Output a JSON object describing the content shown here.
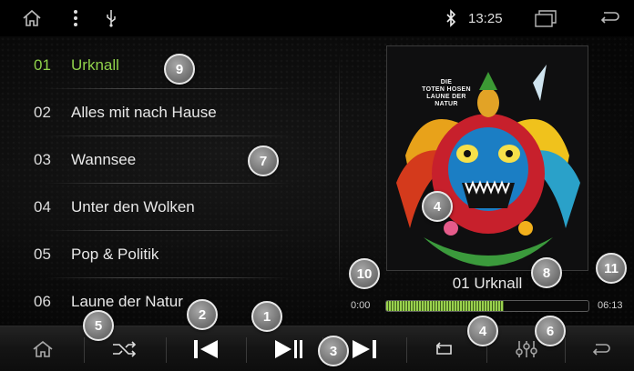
{
  "status_bar": {
    "time": "13:25",
    "icons": {
      "home": "home-icon",
      "menu": "vertical-dots-icon",
      "usb": "usb-icon",
      "bluetooth": "bluetooth-icon",
      "recent": "recent-apps-icon",
      "back": "back-icon"
    }
  },
  "playlist": [
    {
      "num": "01",
      "title": "Urknall",
      "active": true
    },
    {
      "num": "02",
      "title": "Alles mit nach Hause",
      "active": false
    },
    {
      "num": "03",
      "title": "Wannsee",
      "active": false
    },
    {
      "num": "04",
      "title": "Unter den Wolken",
      "active": false
    },
    {
      "num": "05",
      "title": "Pop & Politik",
      "active": false
    },
    {
      "num": "06",
      "title": "Laune der Natur",
      "active": false
    }
  ],
  "now_playing": {
    "title": "01 Urknall",
    "current_time": "0:00",
    "total_time": "06:13",
    "progress": 0.58,
    "cover_text": "DIE\nTOTEN HOSEN\nLAUNE DER\nNATUR"
  },
  "controls": {
    "icons": [
      "home-icon",
      "shuffle-icon",
      "previous-icon",
      "play-pause-icon",
      "next-icon",
      "repeat-icon",
      "equalizer-icon",
      "back-icon"
    ]
  },
  "callouts": [
    "1",
    "2",
    "3",
    "4",
    "4",
    "5",
    "6",
    "7",
    "8",
    "9",
    "10",
    "11"
  ],
  "colors": {
    "active_track": "#8fd14a",
    "progress": "#9ad24e",
    "background": "#000000"
  }
}
